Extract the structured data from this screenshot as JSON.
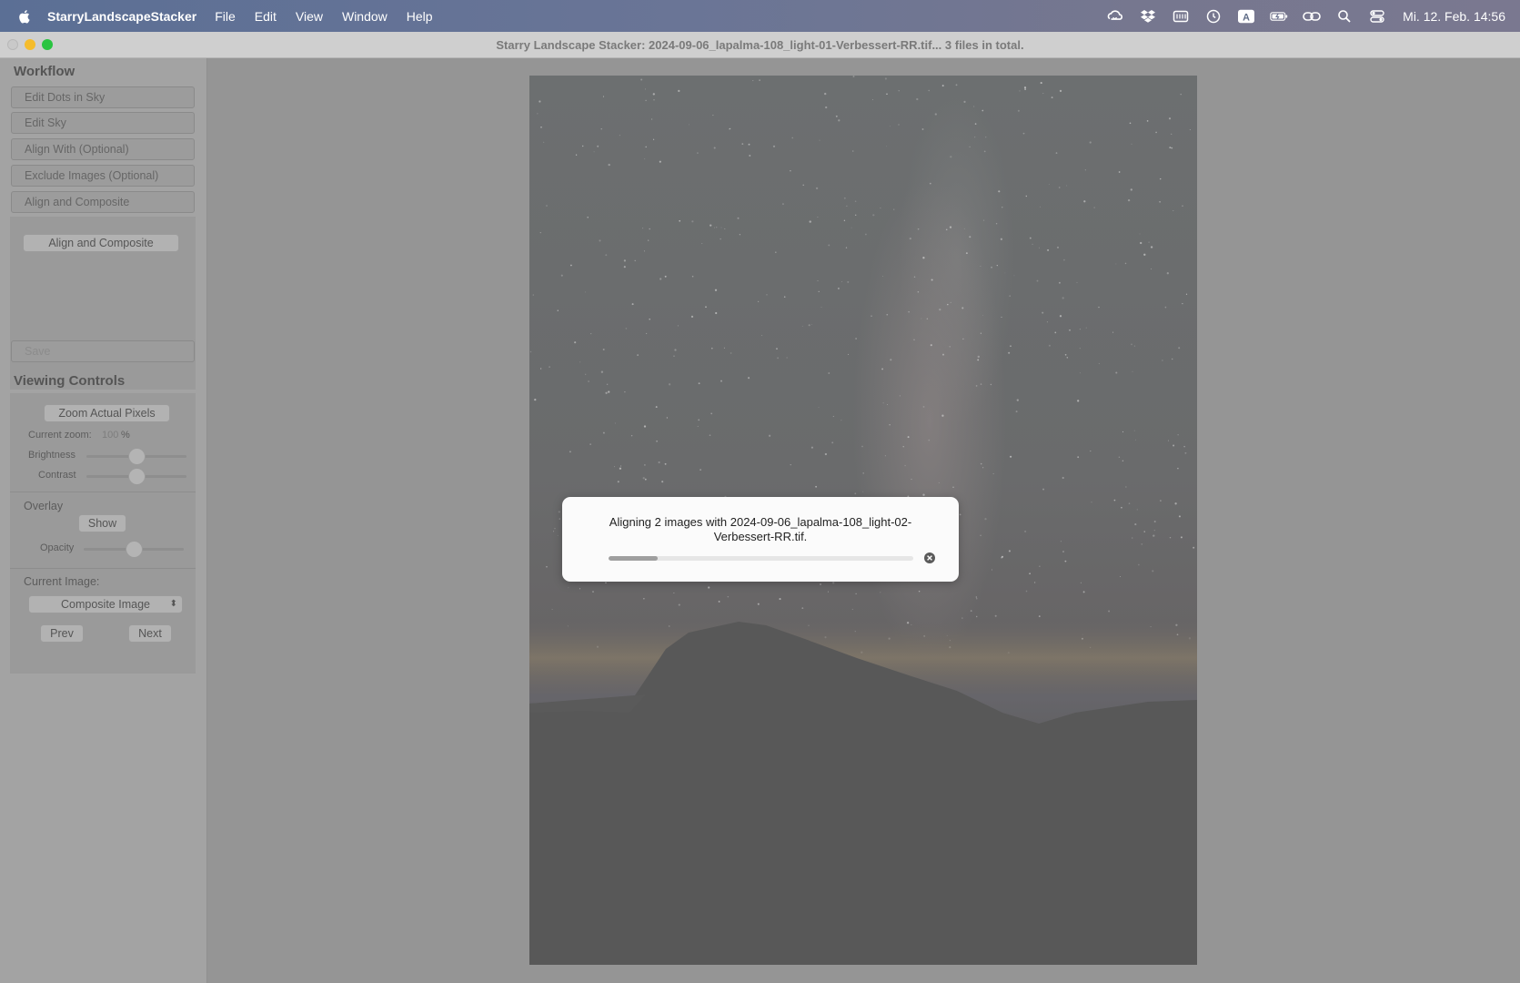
{
  "menubar": {
    "app_name": "StarryLandscapeStacker",
    "items": [
      "File",
      "Edit",
      "View",
      "Window",
      "Help"
    ],
    "status_icons": [
      "creative-cloud-icon",
      "dropbox-icon",
      "keyboard-layout-icon",
      "time-machine-icon",
      "input-source-icon",
      "battery-charging-icon",
      "link-icon",
      "spotlight-search-icon",
      "control-center-icon"
    ],
    "input_source_letter": "A",
    "clock": "Mi. 12. Feb.  14:56"
  },
  "window": {
    "title": "Starry Landscape Stacker: 2024-09-06_lapalma-108_light-01-Verbessert-RR.tif...  3 files in total."
  },
  "sidebar": {
    "workflow_title": "Workflow",
    "workflow_steps": [
      "Edit Dots in Sky",
      "Edit Sky",
      "Align With (Optional)",
      "Exclude Images (Optional)",
      "Align and Composite"
    ],
    "align_button": "Align and Composite",
    "save_button": "Save",
    "viewing_title": "Viewing Controls",
    "zoom_button": "Zoom Actual Pixels",
    "current_zoom_label": "Current zoom:",
    "zoom_value": "100",
    "zoom_unit": "%",
    "brightness_label": "Brightness",
    "contrast_label": "Contrast",
    "brightness_value": 0.5,
    "contrast_value": 0.5,
    "overlay_label": "Overlay",
    "show_button": "Show",
    "opacity_label": "Opacity",
    "opacity_value": 0.5,
    "current_image_label": "Current Image:",
    "current_image_select": "Composite Image",
    "prev_button": "Prev",
    "next_button": "Next"
  },
  "dialog": {
    "message": "Aligning 2 images with 2024-09-06_lapalma-108_light-02-Verbessert-RR.tif.",
    "progress": 0.16
  },
  "colors": {
    "menubar_start": "#5b6f95",
    "menubar_end": "#7a7890",
    "traffic_min": "#f5bc2c",
    "traffic_max": "#29c440"
  }
}
